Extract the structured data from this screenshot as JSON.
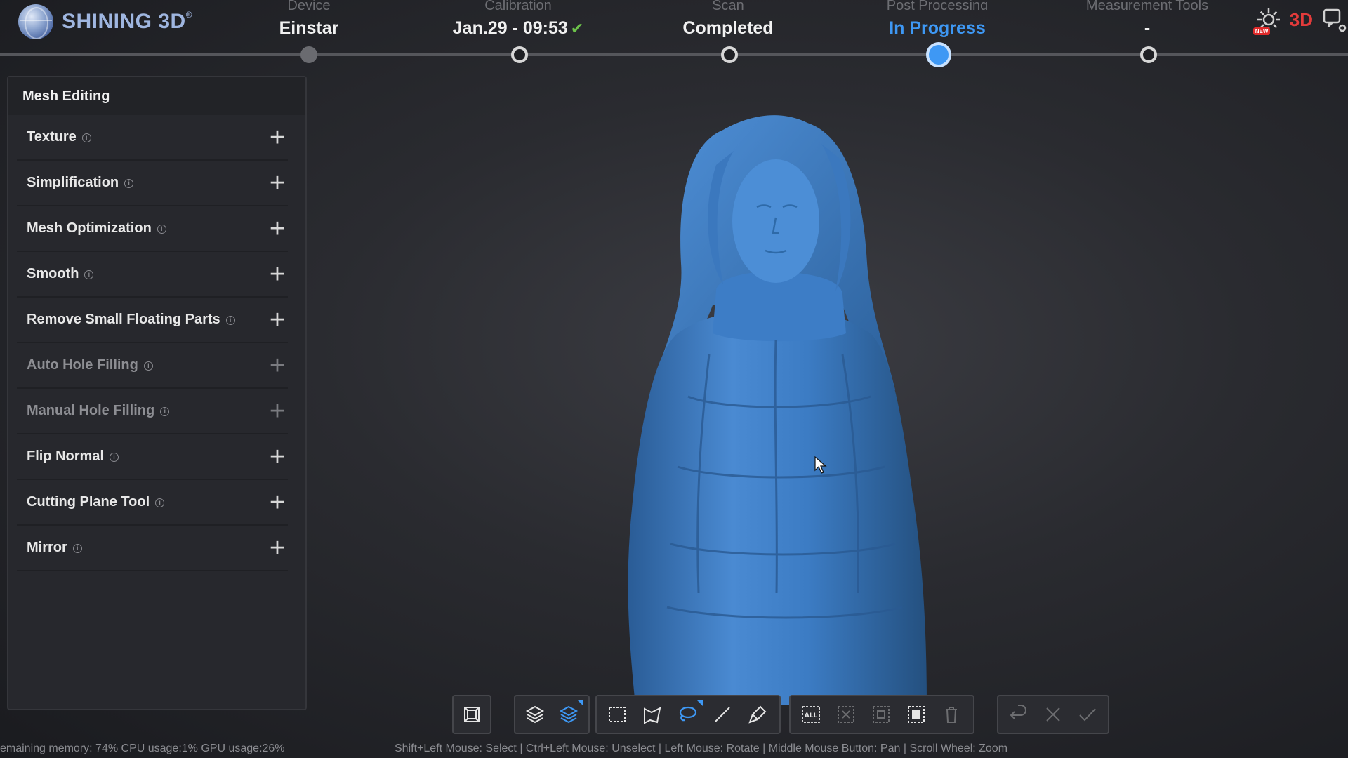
{
  "app": {
    "brand": "SHINING 3D"
  },
  "steps": [
    {
      "label": "Device",
      "value": "Einstar",
      "state": "done"
    },
    {
      "label": "Calibration",
      "value": "Jan.29 - 09:53",
      "state": "todo",
      "check": "✔"
    },
    {
      "label": "Scan",
      "value": "Completed",
      "state": "todo"
    },
    {
      "label": "Post Processing",
      "value": "In Progress",
      "state": "current"
    },
    {
      "label": "Measurement Tools",
      "value": "-",
      "state": "todo"
    }
  ],
  "top_right": {
    "badge": "NEW",
    "brand": "3D"
  },
  "panel": {
    "title": "Mesh Editing",
    "tools": [
      {
        "label": "Texture",
        "enabled": true
      },
      {
        "label": "Simplification",
        "enabled": true
      },
      {
        "label": "Mesh Optimization",
        "enabled": true
      },
      {
        "label": "Smooth",
        "enabled": true
      },
      {
        "label": "Remove Small Floating Parts",
        "enabled": true
      },
      {
        "label": "Auto Hole Filling",
        "enabled": false
      },
      {
        "label": "Manual Hole Filling",
        "enabled": false
      },
      {
        "label": "Flip Normal",
        "enabled": true
      },
      {
        "label": "Cutting Plane Tool",
        "enabled": true
      },
      {
        "label": "Mirror",
        "enabled": true
      }
    ],
    "info_glyph": "i",
    "plus_glyph": "+"
  },
  "toolbar": {
    "select_all_label": "ALL"
  },
  "status": {
    "system": "emaining memory: 74% CPU usage:1% GPU usage:26%",
    "hint": "Shift+Left Mouse: Select | Ctrl+Left Mouse: Unselect | Left Mouse: Rotate | Middle Mouse Button: Pan | Scroll Wheel: Zoom"
  },
  "colors": {
    "accent": "#3e98f4",
    "model": "#3a7ac2",
    "check": "#6cc24a",
    "brand_red": "#e33b3b"
  }
}
